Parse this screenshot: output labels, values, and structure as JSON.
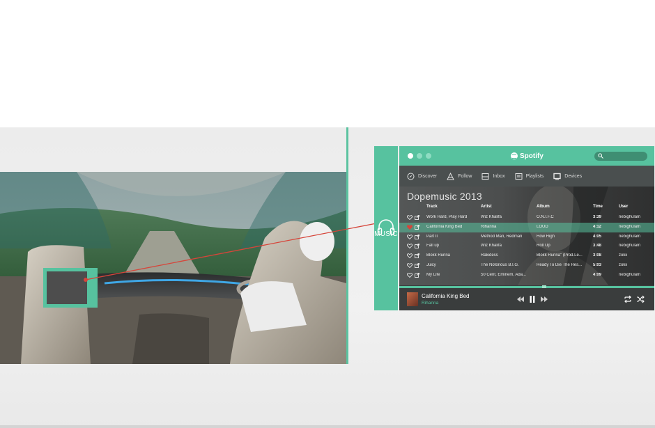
{
  "colors": {
    "accent": "#57c29f",
    "window_bg": "#3b3f3f",
    "connector_line": "#d6453a"
  },
  "side_tab": {
    "icon": "headphones-icon",
    "label": "MUSIC"
  },
  "spotify": {
    "app_name": "Spotify",
    "nav": [
      {
        "label": "Discover",
        "icon": "compass-icon"
      },
      {
        "label": "Follow",
        "icon": "follow-icon"
      },
      {
        "label": "Inbox",
        "icon": "inbox-icon"
      },
      {
        "label": "Playlists",
        "icon": "playlist-icon"
      },
      {
        "label": "Devices",
        "icon": "device-icon"
      }
    ],
    "playlist_title": "Dopemusic 2013",
    "columns": {
      "track": "Track",
      "artist": "Artist",
      "album": "Album",
      "time": "Time",
      "user": "User"
    },
    "tracks": [
      {
        "track": "Work Hard, Play Hard",
        "artist": "Wiz Khalifa",
        "album": "O.N.I.F.C",
        "time": "3:39",
        "user": "nebighulam"
      },
      {
        "track": "California King Bed",
        "artist": "Rihanna",
        "album": "LOUD",
        "time": "4:12",
        "user": "nebighulam"
      },
      {
        "track": "Part II",
        "artist": "Method Man, Redman",
        "album": "How High",
        "time": "4:05",
        "user": "nebighulam"
      },
      {
        "track": "Fall up",
        "artist": "Wiz Khalifa",
        "album": "Roll Up",
        "time": "3:48",
        "user": "nebighulam"
      },
      {
        "track": "Blokk Runna",
        "artist": "Rakidess",
        "album": "Blokk Runna\" (Prod.Le...",
        "time": "3:08",
        "user": "zokii"
      },
      {
        "track": "Juicy",
        "artist": "The Notorious B.I.G.",
        "album": "Ready To Die The Res...",
        "time": "5:03",
        "user": "zokii"
      },
      {
        "track": "My Life",
        "artist": "50 Cent, Eminem, Ada...",
        "album": "",
        "time": "4:09",
        "user": "nebighulam"
      }
    ],
    "active_track_index": 1,
    "seek_position_fraction": 0.56,
    "now_playing": {
      "track": "California King Bed",
      "artist": "Rihanna"
    }
  }
}
